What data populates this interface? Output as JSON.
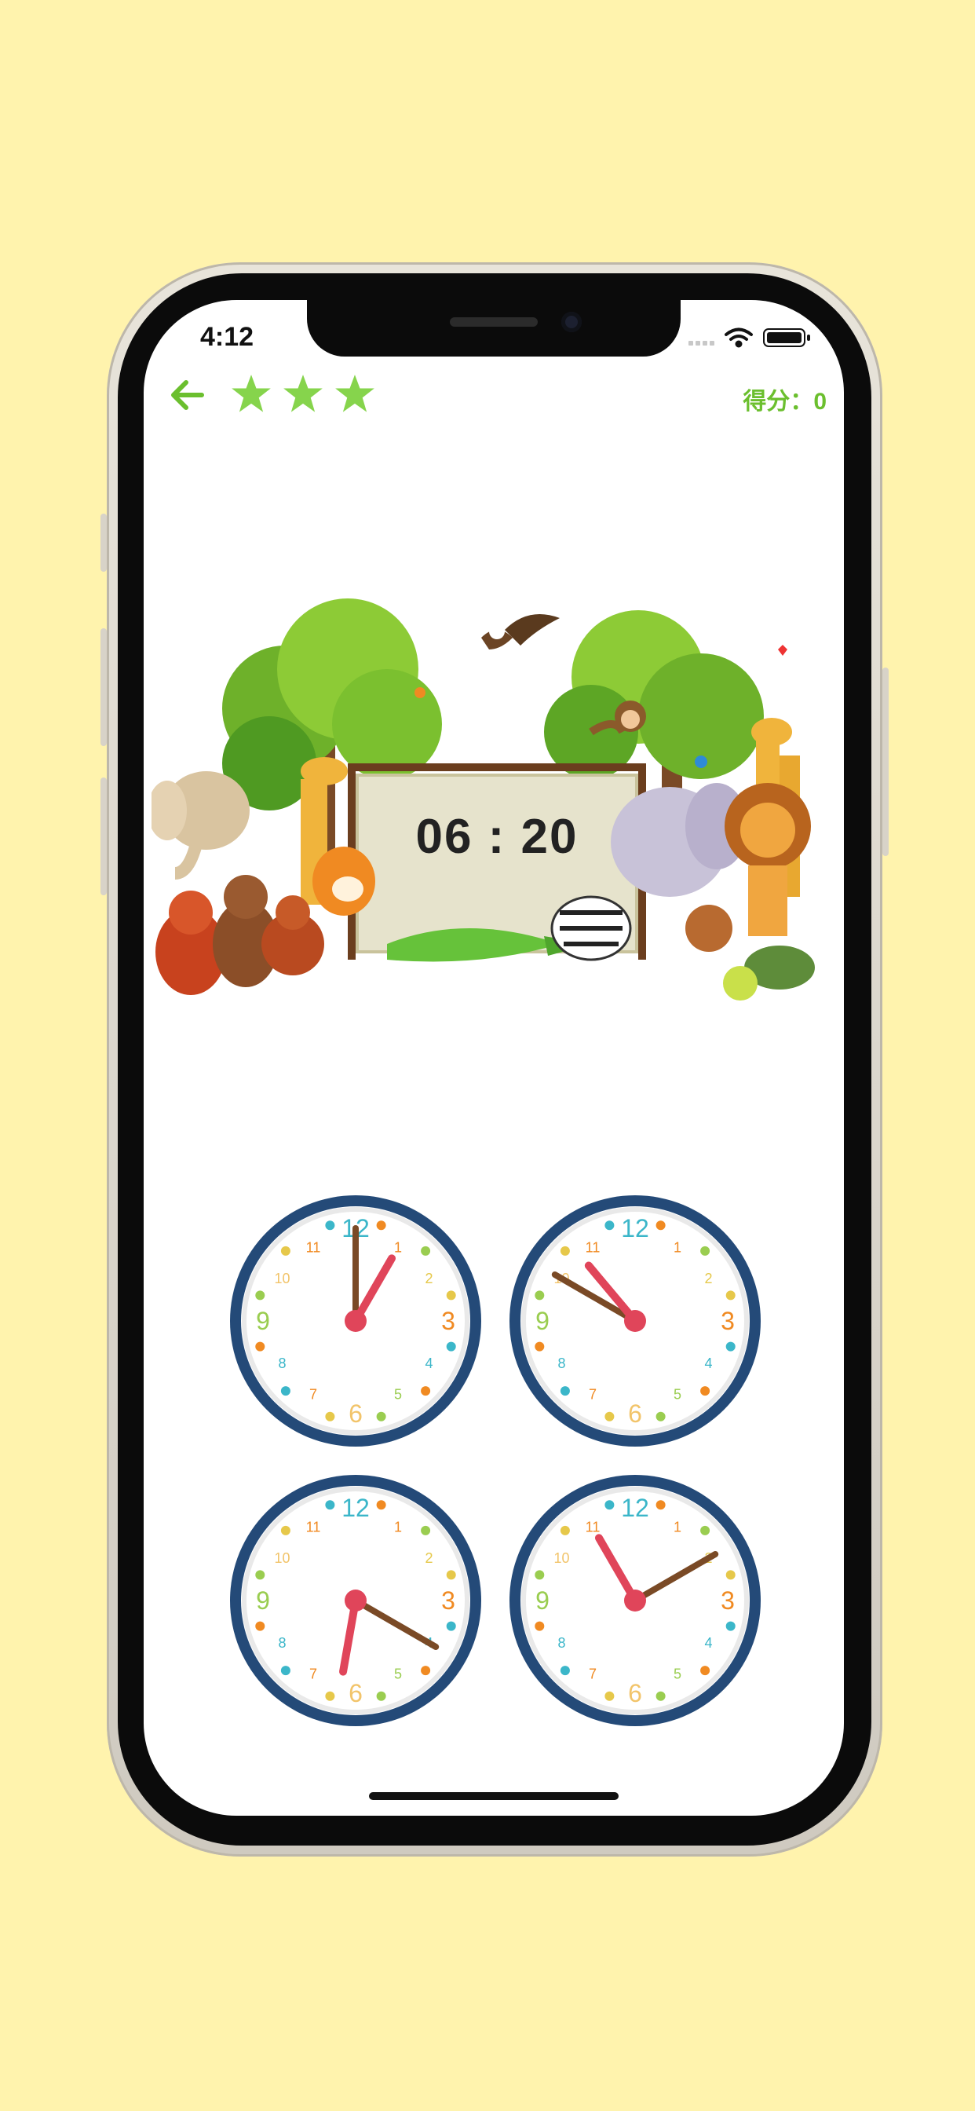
{
  "status_bar": {
    "time": "4:12"
  },
  "header": {
    "back_icon": "arrow-left-icon",
    "stars": 3,
    "score_label": "得分：",
    "score_value": "0"
  },
  "question": {
    "target_time": "06 : 20"
  },
  "clock_face_numbers": [
    "12",
    "1",
    "2",
    "3",
    "4",
    "5",
    "6",
    "7",
    "8",
    "9",
    "10",
    "11"
  ],
  "clock_options": [
    {
      "hour_hand_deg": 30,
      "minute_hand_deg": 0
    },
    {
      "hour_hand_deg": -40,
      "minute_hand_deg": -60
    },
    {
      "hour_hand_deg": 190,
      "minute_hand_deg": 120
    },
    {
      "hour_hand_deg": -30,
      "minute_hand_deg": 60
    }
  ],
  "colors": {
    "background": "#FFF3AD",
    "accent_green": "#6BBF2E",
    "hour_hand": "#E0455A",
    "minute_hand": "#7A4A26",
    "clock_rim": "#244A78"
  }
}
